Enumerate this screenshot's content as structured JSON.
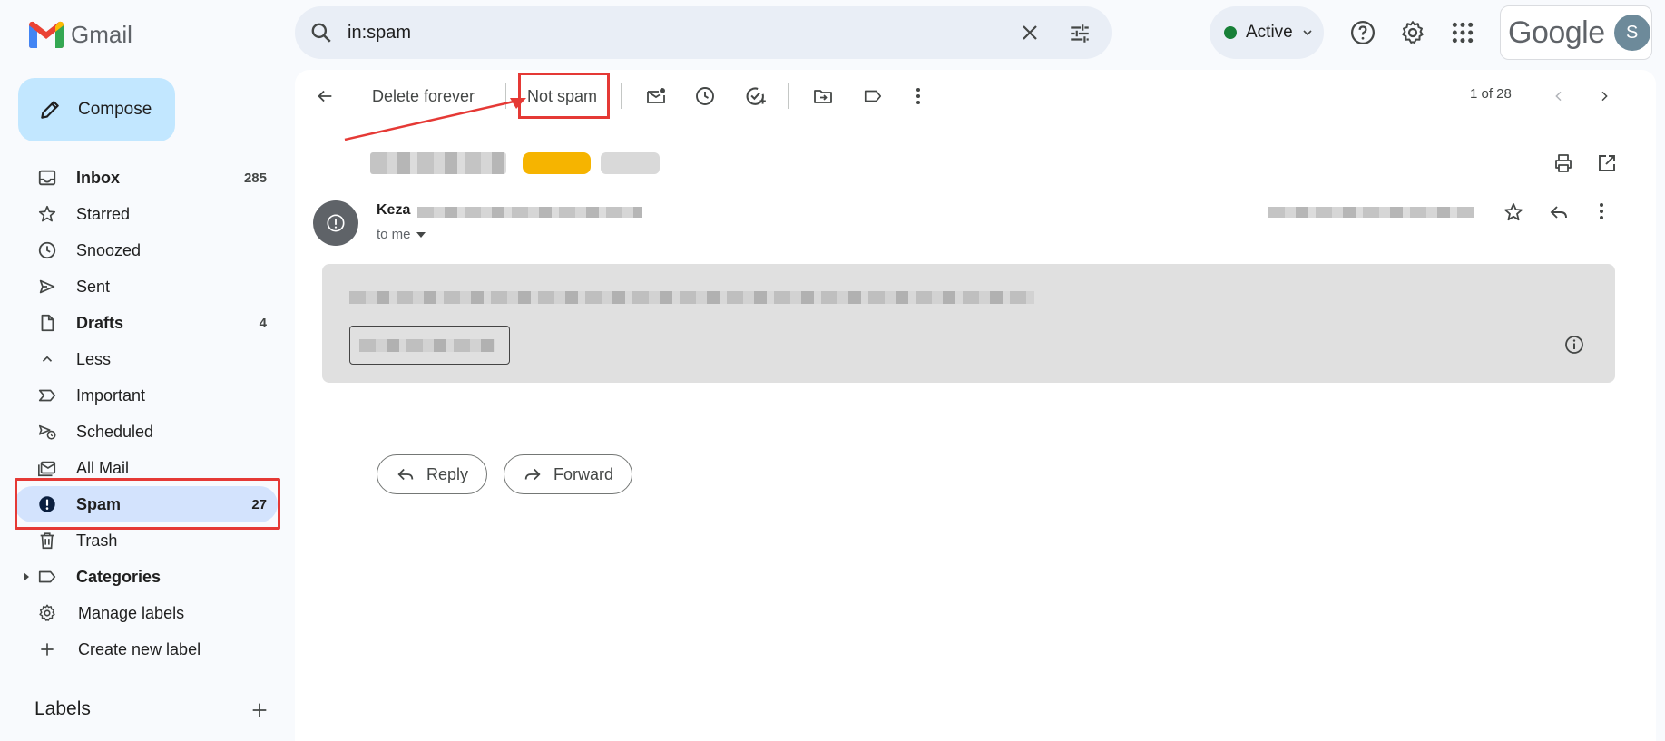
{
  "app": {
    "name": "Gmail",
    "brand": "Google",
    "avatar_letter": "S"
  },
  "search": {
    "query": "in:spam"
  },
  "status": {
    "label": "Active",
    "color": "#188038"
  },
  "compose": {
    "label": "Compose"
  },
  "nav": {
    "items": [
      {
        "label": "Inbox",
        "count": "285",
        "icon": "inbox-icon"
      },
      {
        "label": "Starred",
        "count": "",
        "icon": "star-icon"
      },
      {
        "label": "Snoozed",
        "count": "",
        "icon": "clock-icon"
      },
      {
        "label": "Sent",
        "count": "",
        "icon": "send-icon"
      },
      {
        "label": "Drafts",
        "count": "4",
        "icon": "draft-icon"
      },
      {
        "label": "Less",
        "count": "",
        "icon": "chevron-up-icon"
      },
      {
        "label": "Important",
        "count": "",
        "icon": "important-icon"
      },
      {
        "label": "Scheduled",
        "count": "",
        "icon": "scheduled-icon"
      },
      {
        "label": "All Mail",
        "count": "",
        "icon": "all-mail-icon"
      },
      {
        "label": "Spam",
        "count": "27",
        "icon": "spam-icon"
      },
      {
        "label": "Trash",
        "count": "",
        "icon": "trash-icon"
      },
      {
        "label": "Categories",
        "count": "",
        "icon": "label-icon"
      },
      {
        "label": "Manage labels",
        "count": "",
        "icon": "gear-icon"
      },
      {
        "label": "Create new label",
        "count": "",
        "icon": "plus-icon"
      }
    ],
    "labels_heading": "Labels"
  },
  "toolbar": {
    "delete_forever": "Delete forever",
    "not_spam": "Not spam",
    "pager": "1 of 28"
  },
  "message": {
    "sender_name": "Keza",
    "to": "to me"
  },
  "actions": {
    "reply": "Reply",
    "forward": "Forward"
  },
  "colors": {
    "accent": "#c2e7ff",
    "selected": "#d3e3fd",
    "highlight": "#e53935"
  }
}
